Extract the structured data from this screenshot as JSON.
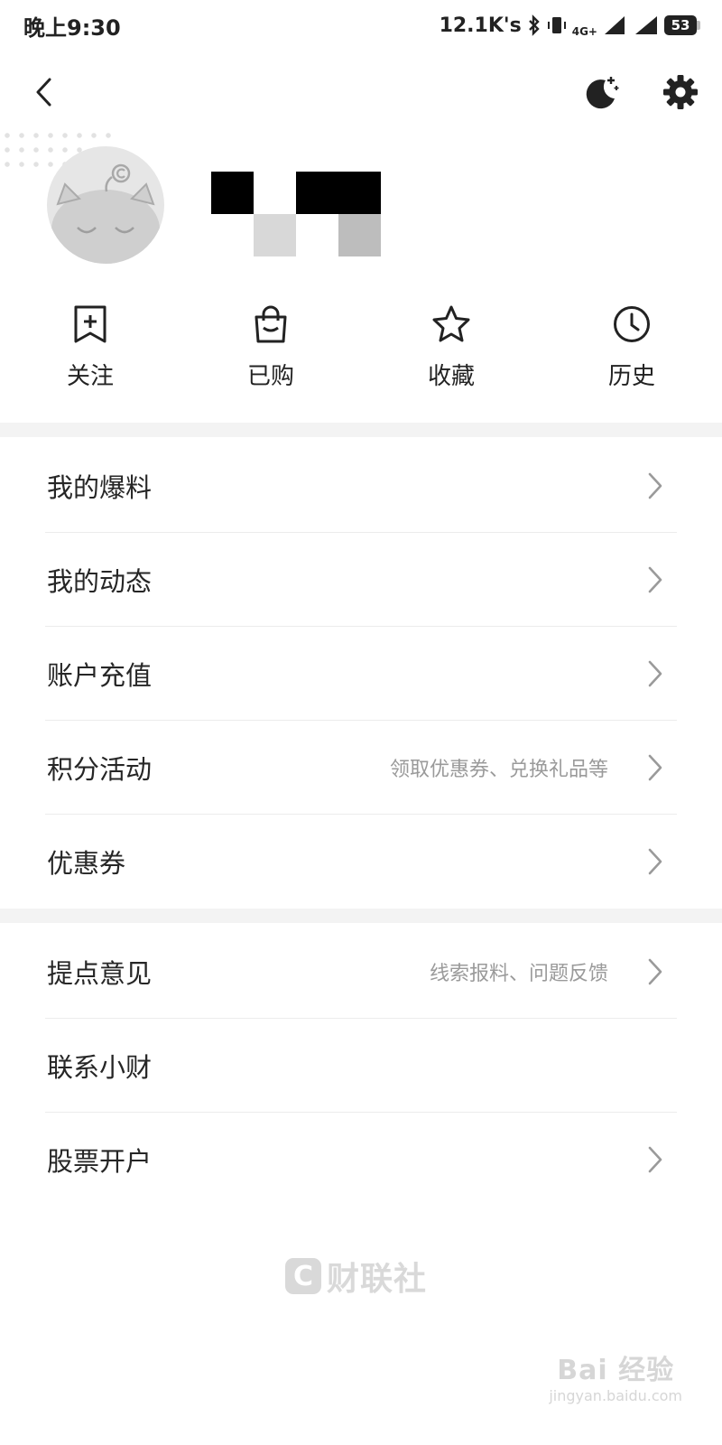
{
  "status_bar": {
    "time": "晚上9:30",
    "network_speed": "12.1K's",
    "network_type": "4G+",
    "battery": "53"
  },
  "header": {
    "back_icon": "chevron-left-icon",
    "night_mode_icon": "moon-icon",
    "settings_icon": "gear-icon"
  },
  "quick_actions": [
    {
      "label": "关注",
      "icon": "bookmark-plus-icon"
    },
    {
      "label": "已购",
      "icon": "shopping-bag-icon"
    },
    {
      "label": "收藏",
      "icon": "star-icon"
    },
    {
      "label": "历史",
      "icon": "clock-icon"
    }
  ],
  "menu_group_1": [
    {
      "label": "我的爆料",
      "subtitle": "",
      "has_arrow": true
    },
    {
      "label": "我的动态",
      "subtitle": "",
      "has_arrow": true
    },
    {
      "label": "账户充值",
      "subtitle": "",
      "has_arrow": true
    },
    {
      "label": "积分活动",
      "subtitle": "领取优惠券、兑换礼品等",
      "has_arrow": true
    },
    {
      "label": "优惠券",
      "subtitle": "",
      "has_arrow": true
    }
  ],
  "menu_group_2": [
    {
      "label": "提点意见",
      "subtitle": "线索报料、问题反馈",
      "has_arrow": true
    },
    {
      "label": "联系小财",
      "subtitle": "",
      "has_arrow": false
    },
    {
      "label": "股票开户",
      "subtitle": "",
      "has_arrow": true
    }
  ],
  "footer": {
    "logo_mark": "C",
    "logo_text": "财联社"
  },
  "watermark": {
    "main": "Bai 经验",
    "sub": "jingyan.baidu.com"
  },
  "colors": {
    "background": "#ffffff",
    "divider_band": "#f3f3f3",
    "text_primary": "#262626",
    "text_secondary": "#9a9a9a"
  }
}
